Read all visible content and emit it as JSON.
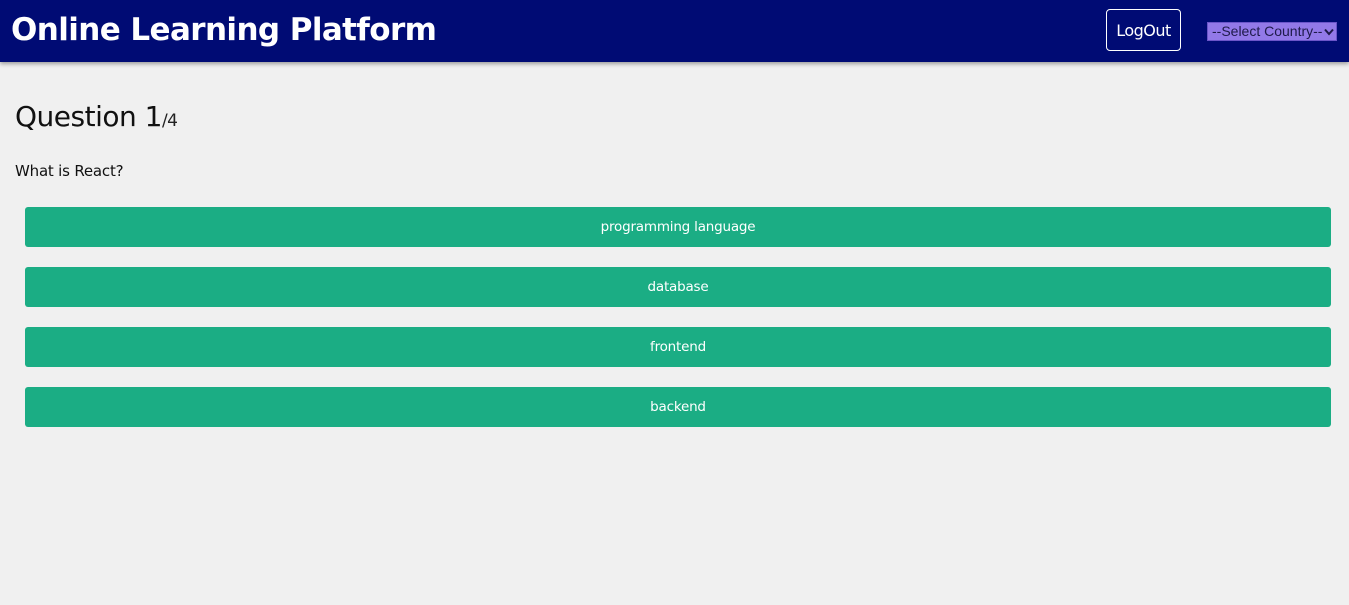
{
  "app": {
    "title": "Online Learning Platform"
  },
  "header": {
    "logout_label": "LogOut",
    "country_select": {
      "selected": "--Select Country--"
    }
  },
  "quiz": {
    "question_label": "Question 1",
    "question_total": "/4",
    "question_text": "What is React?",
    "answers": [
      "programming language",
      "database",
      "frontend",
      "backend"
    ]
  },
  "colors": {
    "header_bg": "#000b74",
    "answer_bg": "#1bad84",
    "select_bg": "#9279e8",
    "page_bg": "#f0f0f0"
  },
  "icons": {
    "select_arrow": "chevron-down-icon"
  }
}
